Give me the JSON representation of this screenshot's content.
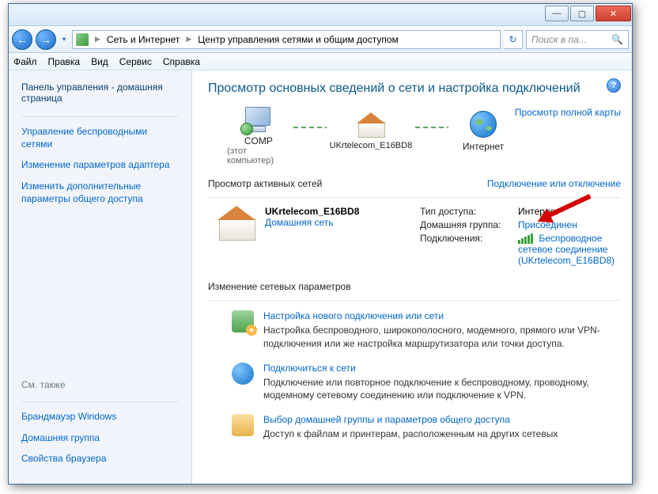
{
  "titlebar": {
    "minimize": "—",
    "maximize": "▢",
    "close": "✕"
  },
  "nav": {
    "back": "←",
    "forward": "→",
    "drop": "▾",
    "refresh": "↻"
  },
  "address": {
    "crumb1": "Сеть и Интернет",
    "crumb2": "Центр управления сетями и общим доступом"
  },
  "search": {
    "placeholder": "Поиск в па...",
    "icon": "🔍"
  },
  "menu": {
    "file": "Файл",
    "edit": "Правка",
    "view": "Вид",
    "service": "Сервис",
    "help": "Справка"
  },
  "sidebar": {
    "home": "Панель управления - домашняя страница",
    "links": [
      "Управление беспроводными сетями",
      "Изменение параметров адаптера",
      "Изменить дополнительные параметры общего доступа"
    ],
    "see_also_title": "См. также",
    "see_also": [
      "Брандмауэр Windows",
      "Домашняя группа",
      "Свойства браузера"
    ]
  },
  "content": {
    "help": "?",
    "heading": "Просмотр основных сведений о сети и настройка подключений",
    "full_map": "Просмотр полной карты",
    "topology": {
      "computer": "COMP",
      "computer_sub": "(этот компьютер)",
      "network": "UKrtelecom_E16BD8",
      "internet": "Интернет"
    },
    "active_label": "Просмотр активных сетей",
    "connect_disconnect": "Подключение или отключение",
    "active_network": {
      "name": "UKrtelecom_E16BD8",
      "type_link": "Домашняя сеть"
    },
    "details": {
      "access_key": "Тип доступа:",
      "access_val": "Интернет",
      "homegroup_key": "Домашняя группа:",
      "homegroup_val": "Присоединен",
      "conn_key": "Подключения:",
      "conn_val": "Беспроводное сетевое соединение (UKrtelecom_E16BD8)"
    },
    "change_title": "Изменение сетевых параметров",
    "actions": [
      {
        "title": "Настройка нового подключения или сети",
        "desc": "Настройка беспроводного, широкополосного, модемного, прямого или VPN-подключения или же настройка маршрутизатора или точки доступа."
      },
      {
        "title": "Подключиться к сети",
        "desc": "Подключение или повторное подключение к беспроводному, проводному, модемному сетевому соединению или подключение к VPN."
      },
      {
        "title": "Выбор домашней группы и параметров общего доступа",
        "desc": "Доступ к файлам и принтерам, расположенным на других сетевых"
      }
    ]
  }
}
